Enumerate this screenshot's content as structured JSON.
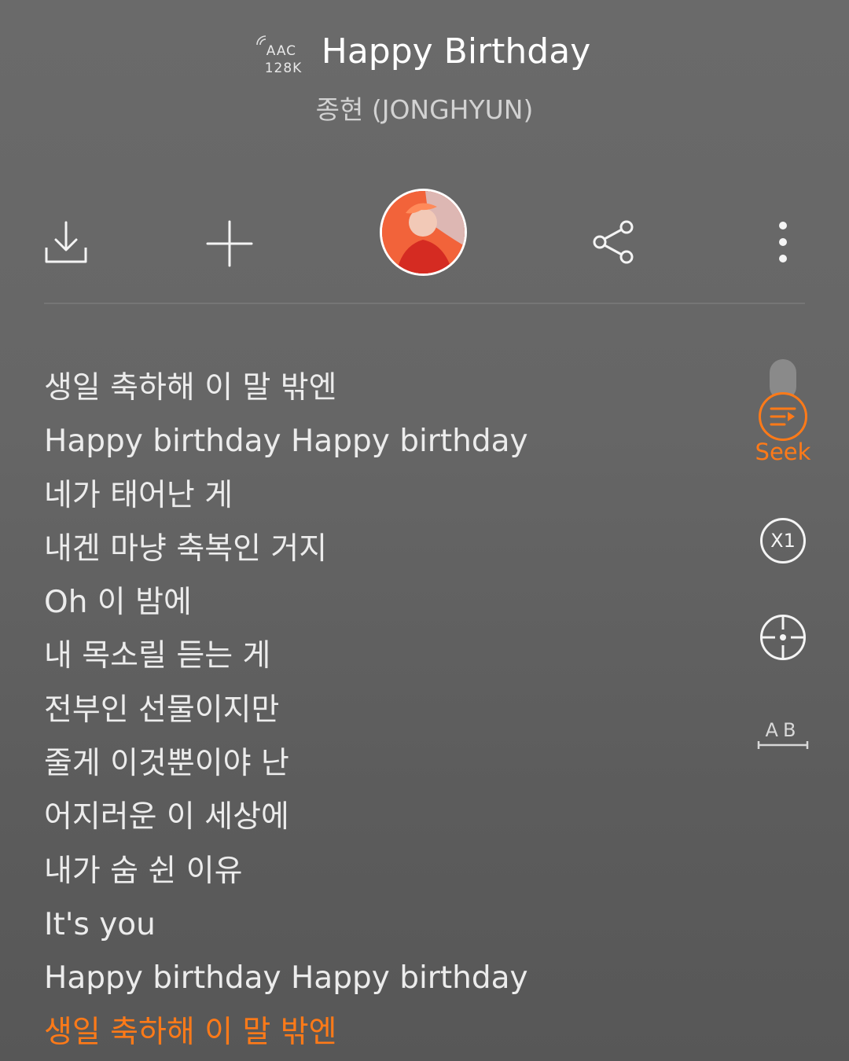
{
  "header": {
    "codec_line1": "AAC",
    "codec_line2": "128K",
    "song_title": "Happy Birthday",
    "artist": "종현 (JONGHYUN)"
  },
  "toolbar": {
    "download_icon": "download-icon",
    "add_icon": "plus-icon",
    "album_art": "album-art-thumbnail",
    "share_icon": "share-icon",
    "more_icon": "more-vertical-icon"
  },
  "lyrics": [
    "생일 축하해 이 말 밖엔",
    "Happy birthday Happy birthday",
    "네가 태어난 게",
    "내겐 마냥 축복인 거지",
    "Oh 이 밤에",
    "내 목소릴 듣는 게",
    "전부인 선물이지만",
    "줄게 이것뿐이야 난",
    "어지러운 이 세상에",
    "내가 숨 쉰 이유",
    "It's you",
    "Happy birthday Happy birthday",
    "생일 축하해 이 말 밖엔"
  ],
  "active_lyric_index": 12,
  "side_controls": {
    "seek_label": "Seek",
    "speed_label": "X1",
    "ab_label": "AB"
  },
  "colors": {
    "accent": "#ff7a18",
    "text": "#ececec",
    "background": "#666666"
  }
}
